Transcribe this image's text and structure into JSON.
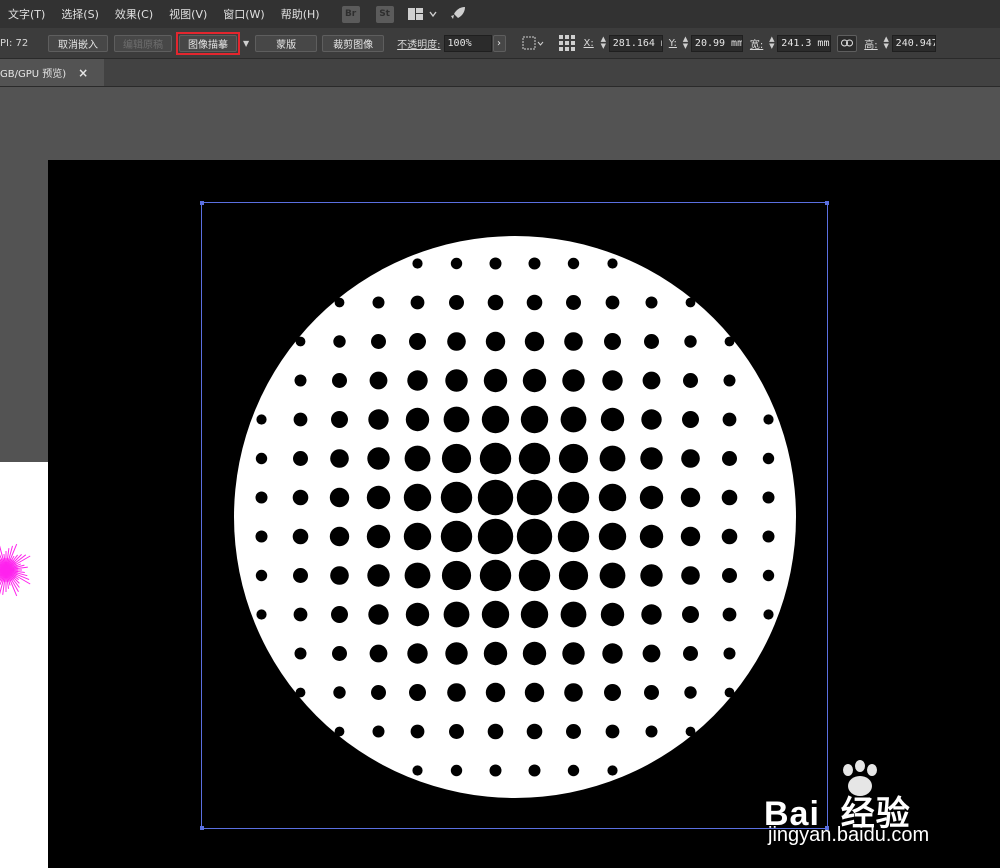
{
  "menu": [
    "文字(T)",
    "选择(S)",
    "效果(C)",
    "视图(V)",
    "窗口(W)",
    "帮助(H)"
  ],
  "app_icons": [
    "Br",
    "St"
  ],
  "control": {
    "ppi": "PI: 72",
    "unembed": "取消嵌入",
    "edit_original": "编辑原稿",
    "image_trace": "图像描摹",
    "mask": "蒙版",
    "crop": "裁剪图像",
    "opacity_label": "不透明度:",
    "opacity_value": "100%",
    "x_label": "X:",
    "x_value": "281.164 m",
    "y_label": "Y:",
    "y_value": "20.99 mm",
    "w_label": "宽:",
    "w_value": "241.3 mm",
    "h_label": "高:",
    "h_value": "240.947"
  },
  "tab": {
    "title": "GB/GPU 预览)",
    "close": "×"
  },
  "halftone": {
    "rows": 14,
    "cols": 14,
    "min_dot_ratio": 0.12,
    "max_dot_ratio": 1.0
  },
  "watermark": {
    "logo": "Bai  经验",
    "url": "jingyan.baidu.com"
  },
  "colors": {
    "ui_dark": "#323232",
    "control_bar": "#3c3c3c",
    "canvas": "#535353",
    "selection": "#5a6fe0",
    "highlight": "#e3262e",
    "magenta": "#ff22ee"
  }
}
